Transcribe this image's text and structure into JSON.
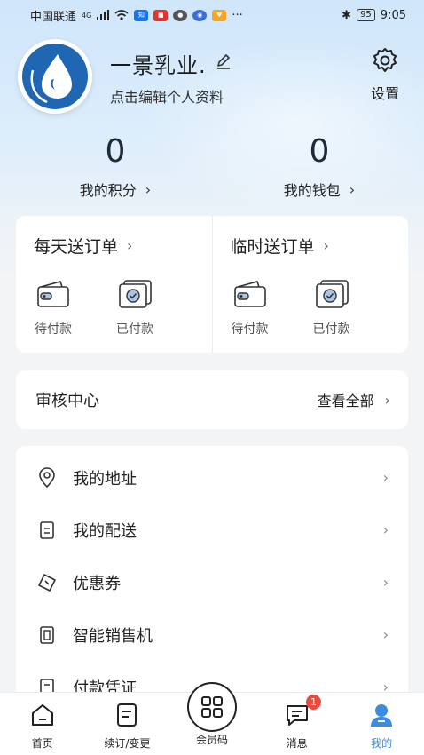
{
  "status_bar": {
    "carrier": "中国联通",
    "network": "4G",
    "battery": "95",
    "time": "9:05",
    "more": "···"
  },
  "profile": {
    "username": "一景乳业.",
    "edit_hint": "点击编辑个人资料",
    "settings_label": "设置"
  },
  "stats": {
    "points_value": "0",
    "points_label": "我的积分",
    "wallet_value": "0",
    "wallet_label": "我的钱包"
  },
  "orders": {
    "daily": {
      "title": "每天送订单",
      "pending_label": "待付款",
      "paid_label": "已付款"
    },
    "temp": {
      "title": "临时送订单",
      "pending_label": "待付款",
      "paid_label": "已付款"
    }
  },
  "audit": {
    "title": "审核中心",
    "view_all": "查看全部"
  },
  "menu": {
    "items": [
      {
        "label": "我的地址",
        "icon": "location-pin-icon"
      },
      {
        "label": "我的配送",
        "icon": "delivery-doc-icon"
      },
      {
        "label": "优惠券",
        "icon": "coupon-icon"
      },
      {
        "label": "智能销售机",
        "icon": "vending-machine-icon"
      },
      {
        "label": "付款凭证",
        "icon": "receipt-icon"
      }
    ]
  },
  "tabbar": {
    "home": "首页",
    "renew": "续订/变更",
    "member_code": "会员码",
    "messages": "消息",
    "messages_badge": "1",
    "mine": "我的"
  },
  "colors": {
    "accent": "#3a8de0",
    "avatar_blue": "#1f67b3",
    "badge_red": "#e84b3c"
  }
}
